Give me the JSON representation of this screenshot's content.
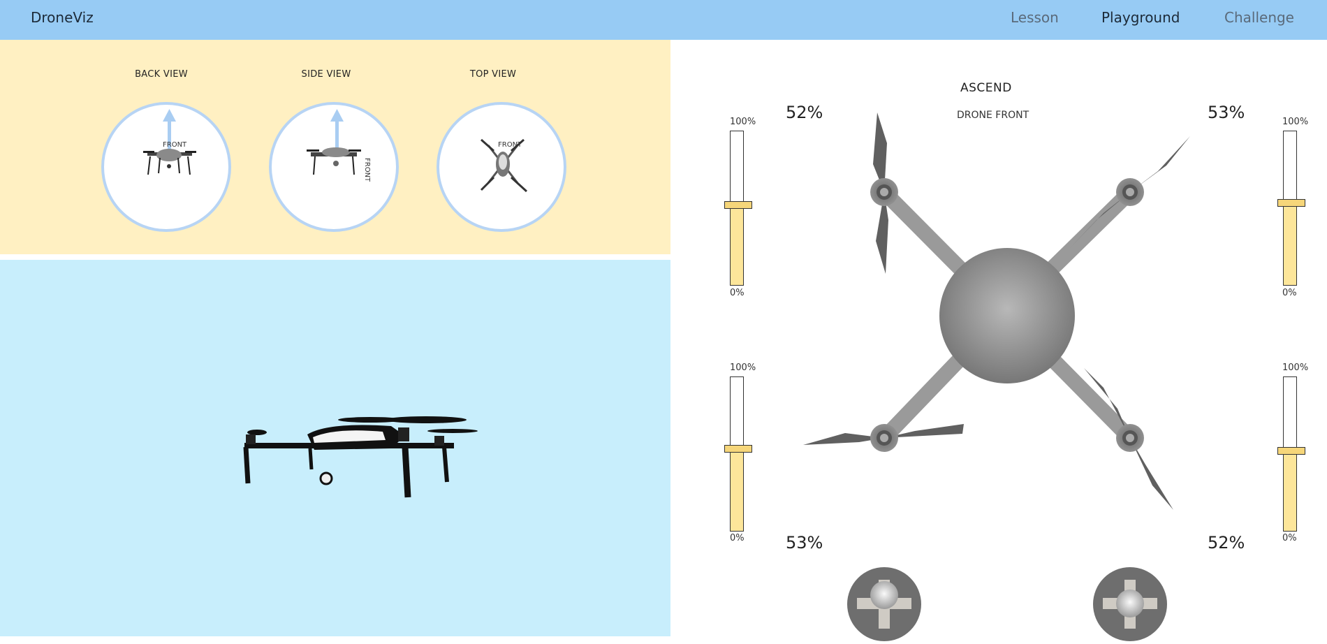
{
  "app": {
    "title": "DroneViz"
  },
  "nav": {
    "lesson": "Lesson",
    "playground": "Playground",
    "challenge": "Challenge",
    "active": "Playground"
  },
  "views": {
    "back": {
      "title": "BACK VIEW",
      "front_label": "FRONT"
    },
    "side": {
      "title": "SIDE VIEW",
      "front_label": "FRONT"
    },
    "top": {
      "title": "TOP VIEW",
      "front_label": "FRONT"
    }
  },
  "control": {
    "mode": "ASCEND",
    "drone_front_label": "DRONE FRONT",
    "motors": {
      "front_left": {
        "percent_label": "52%",
        "level": 0.52
      },
      "front_right": {
        "percent_label": "53%",
        "level": 0.53
      },
      "back_left": {
        "percent_label": "53%",
        "level": 0.53
      },
      "back_right": {
        "percent_label": "52%",
        "level": 0.52
      }
    },
    "slider_max_label": "100%",
    "slider_min_label": "0%"
  },
  "colors": {
    "header": "#97cbf4",
    "views_bg": "#fff0c2",
    "scene_bg": "#c8eefc",
    "slider_fill": "#fde69a",
    "drone_body": "#9a9a9a",
    "propeller": "#5f5f5f"
  },
  "icons": {
    "up_arrow": "up-arrow-icon",
    "joystick": "joystick-icon"
  }
}
